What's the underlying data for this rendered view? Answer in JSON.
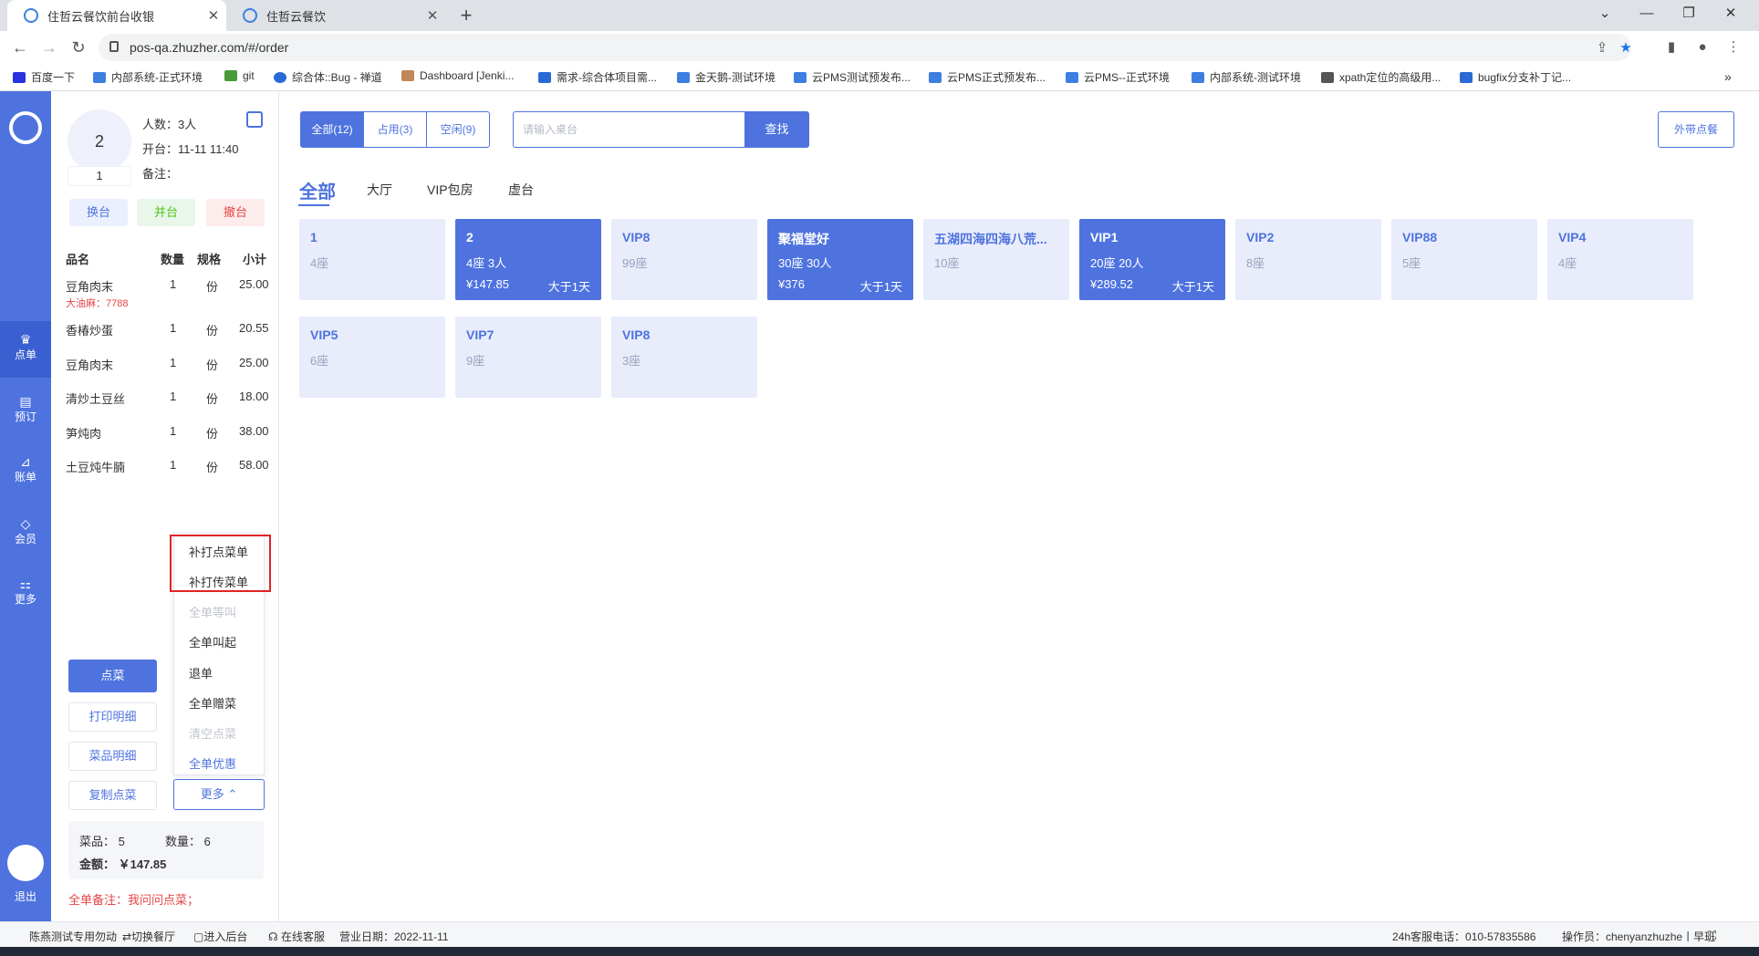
{
  "browser": {
    "tabs": [
      {
        "title": "住哲云餐饮前台收银"
      },
      {
        "title": "住哲云餐饮"
      }
    ],
    "url": "pos-qa.zhuzher.com/#/order",
    "bookmarks": [
      "百度一下",
      "内部系统-正式环境",
      "git",
      "综合体::Bug - 禅道",
      "Dashboard [Jenki...",
      "需求-综合体项目需...",
      "金天鹅-测试环境",
      "云PMS测试预发布...",
      "云PMS正式预发布...",
      "云PMS--正式环境",
      "内部系统-测试环境",
      "xpath定位的高级用...",
      "bugfix分支补丁记..."
    ]
  },
  "nav": {
    "items": [
      {
        "label": "点单",
        "icon": "food-icon"
      },
      {
        "label": "预订",
        "icon": "calendar-icon"
      },
      {
        "label": "账单",
        "icon": "bill-icon"
      },
      {
        "label": "会员",
        "icon": "member-icon"
      },
      {
        "label": "更多",
        "icon": "grid-icon"
      }
    ],
    "logout": "退出"
  },
  "order": {
    "table_name": "2",
    "table_count": "1",
    "guests": "人数：3人",
    "open_time": "开台：11-11 11:40",
    "remark_label": "备注：",
    "actions": {
      "change": "换台",
      "merge": "并台",
      "cancel": "撤台"
    },
    "columns": [
      "品名",
      "数量",
      "规格",
      "小计"
    ],
    "items": [
      {
        "name": "豆角肉末",
        "qty": "1",
        "unit": "份",
        "subtotal": "25.00",
        "note": "大油麻：7788"
      },
      {
        "name": "香椿炒蛋",
        "qty": "1",
        "unit": "份",
        "subtotal": "20.55"
      },
      {
        "name": "豆角肉末",
        "qty": "1",
        "unit": "份",
        "subtotal": "25.00"
      },
      {
        "name": "清炒土豆丝",
        "qty": "1",
        "unit": "份",
        "subtotal": "18.00"
      },
      {
        "name": "笋炖肉",
        "qty": "1",
        "unit": "份",
        "subtotal": "38.00"
      },
      {
        "name": "土豆炖牛腩",
        "qty": "1",
        "unit": "份",
        "subtotal": "58.00"
      }
    ],
    "buttons": {
      "order_dish": "点菜",
      "print_detail": "打印明细",
      "dish_detail": "菜品明细",
      "copy_order": "复制点菜",
      "more": "更多 ⌃"
    },
    "more_menu": [
      {
        "label": "补打点菜单",
        "state": "normal"
      },
      {
        "label": "补打传菜单",
        "state": "normal"
      },
      {
        "label": "全单等叫",
        "state": "disabled"
      },
      {
        "label": "全单叫起",
        "state": "normal"
      },
      {
        "label": "退单",
        "state": "normal"
      },
      {
        "label": "全单赠菜",
        "state": "normal"
      },
      {
        "label": "清空点菜",
        "state": "disabled"
      },
      {
        "label": "全单优惠",
        "state": "blue"
      }
    ],
    "summary": {
      "dishes": "菜品：  5",
      "quantity": "数量：  6",
      "amount": "金额：  ￥147.85"
    },
    "whole_remark": "全单备注：我问问点菜；"
  },
  "filters": [
    "全部(12)",
    "占用(3)",
    "空闲(9)"
  ],
  "search": {
    "placeholder": "请输入桌台",
    "button": "查找"
  },
  "takeout": "外带点餐",
  "areas": [
    "全部",
    "大厅",
    "VIP包房",
    "虚台"
  ],
  "tables": [
    {
      "name": "1",
      "seats": "4座",
      "occupied": false
    },
    {
      "name": "2",
      "seats": "4座  3人",
      "price": "¥147.85",
      "duration": "大于1天",
      "occupied": true
    },
    {
      "name": "VIP8",
      "seats": "99座",
      "occupied": false
    },
    {
      "name": "聚福堂好",
      "seats": "30座  30人",
      "price": "¥376",
      "duration": "大于1天",
      "occupied": true
    },
    {
      "name": "五湖四海四海八荒...",
      "seats": "10座",
      "occupied": false
    },
    {
      "name": "VIP1",
      "seats": "20座  20人",
      "price": "¥289.52",
      "duration": "大于1天",
      "occupied": true
    },
    {
      "name": "VIP2",
      "seats": "8座",
      "occupied": false
    },
    {
      "name": "VIP88",
      "seats": "5座",
      "occupied": false
    },
    {
      "name": "VIP4",
      "seats": "4座",
      "occupied": false
    },
    {
      "name": "VIP5",
      "seats": "6座",
      "occupied": false
    },
    {
      "name": "VIP7",
      "seats": "9座",
      "occupied": false
    },
    {
      "name": "VIP8",
      "seats": "3座",
      "occupied": false
    }
  ],
  "statusbar": {
    "store": "陈燕测试专用勿动",
    "switch": "⇄切换餐厅",
    "backend": "▢进入后台",
    "service": "☊ 在线客服",
    "business_date": "营业日期：2022-11-11",
    "hotline": "24h客服电话：010-57835586",
    "operator": "操作员：chenyanzhuzhe丨早班"
  },
  "colors": {
    "accent": "#4e73df",
    "card_idle": "#e8ecfb",
    "danger": "#e54545",
    "highlight_box": "#e02424"
  }
}
